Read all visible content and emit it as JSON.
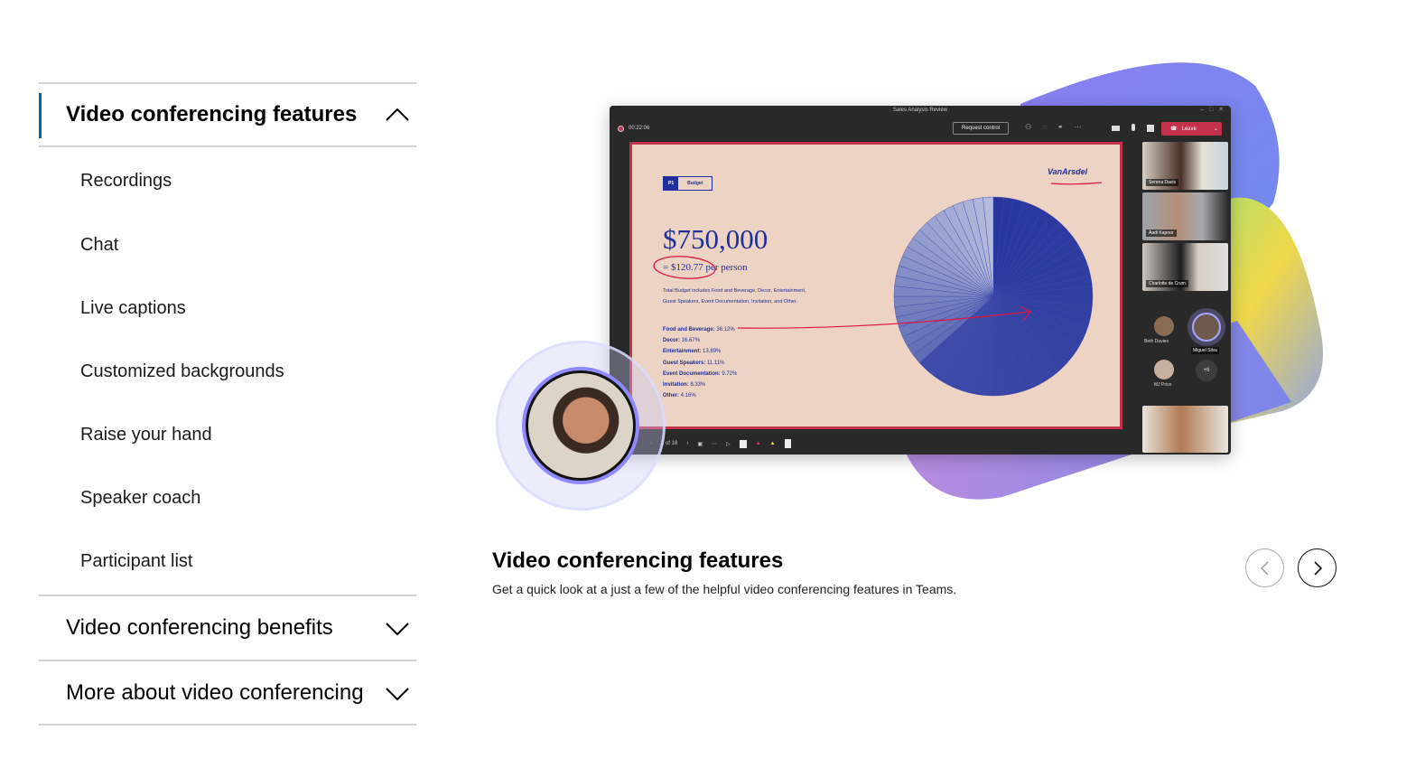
{
  "accordion": {
    "sections": [
      {
        "title": "Video conferencing features",
        "expanded": true,
        "items": [
          "Recordings",
          "Chat",
          "Live captions",
          "Customized backgrounds",
          "Raise your hand",
          "Speaker coach",
          "Participant list"
        ]
      },
      {
        "title": "Video conferencing benefits",
        "expanded": false
      },
      {
        "title": "More about video conferencing",
        "expanded": false
      }
    ]
  },
  "teams": {
    "window_title": "Sales Analysis Review",
    "timer": "00:22:06",
    "request_control": "Request control",
    "leave": "Leave",
    "slide": {
      "tag_num": "P1",
      "tag_label": "Budget",
      "brand": "VanArsdel",
      "amount": "$750,000",
      "per_person": "= $120.77 per person",
      "desc1": "Total Budget includes Food and Beverage, Decor, Entertainment,",
      "desc2": "Guest Speakers, Event Documentation, Invitation, and Other.",
      "legend": [
        {
          "label": "Food and Beverage:",
          "value": "36.12%"
        },
        {
          "label": "Decor:",
          "value": "16.67%"
        },
        {
          "label": "Entertainment:",
          "value": "13.89%"
        },
        {
          "label": "Guest Speakers:",
          "value": "11.11%"
        },
        {
          "label": "Event Documentation:",
          "value": "9.72%"
        },
        {
          "label": "Invitation:",
          "value": "8.33%"
        },
        {
          "label": "Other:",
          "value": "4.16%"
        }
      ]
    },
    "page_counter": "1 of 18",
    "participants": {
      "video": [
        "Serena Davis",
        "Aadi Kapoor",
        "Charlotte de Crum"
      ],
      "avatars": [
        "Beth Davies",
        "Miguel Silva",
        "MJ Price"
      ],
      "more": "+6"
    },
    "colors": {
      "leave": "#c4314b",
      "slide_bg": "#ecd3c3",
      "navy": "#1f2e9a"
    }
  },
  "caption": {
    "title": "Video conferencing features",
    "description": "Get a quick look at a just a few of the helpful video conferencing features in Teams."
  },
  "carousel": {
    "prev_icon": "chevron-left-icon",
    "next_icon": "chevron-right-icon"
  }
}
